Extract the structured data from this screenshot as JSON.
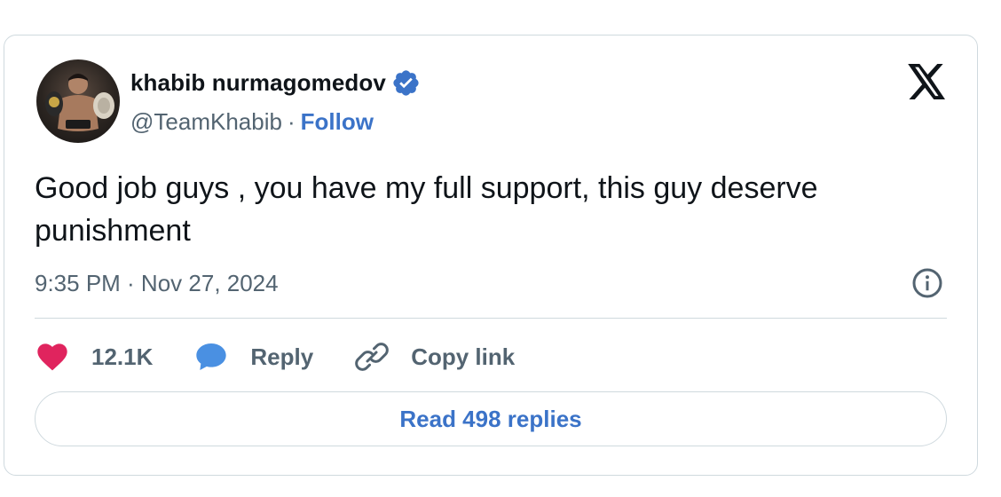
{
  "author": {
    "display_name": "khabib nurmagomedov",
    "handle": "@TeamKhabib",
    "separator": "·",
    "follow_label": "Follow",
    "verified_color": "#3b73c8"
  },
  "tweet": {
    "text": "Good job guys , you have my full support, this guy deserve punishment",
    "timestamp": "9:35 PM · Nov 27, 2024"
  },
  "actions": {
    "like_count": "12.1K",
    "reply_label": "Reply",
    "copy_link_label": "Copy link"
  },
  "read_replies_label": "Read 498 replies",
  "icons": {
    "brand": "x-logo-icon",
    "info": "info-icon",
    "like": "heart-icon",
    "reply": "speech-bubble-icon",
    "copy_link": "link-icon",
    "verified": "verified-badge-icon"
  },
  "colors": {
    "heart": "#e0245e",
    "reply_bubble": "#4a90e2",
    "link_accent": "#3b73c8",
    "muted_text": "#536471"
  }
}
